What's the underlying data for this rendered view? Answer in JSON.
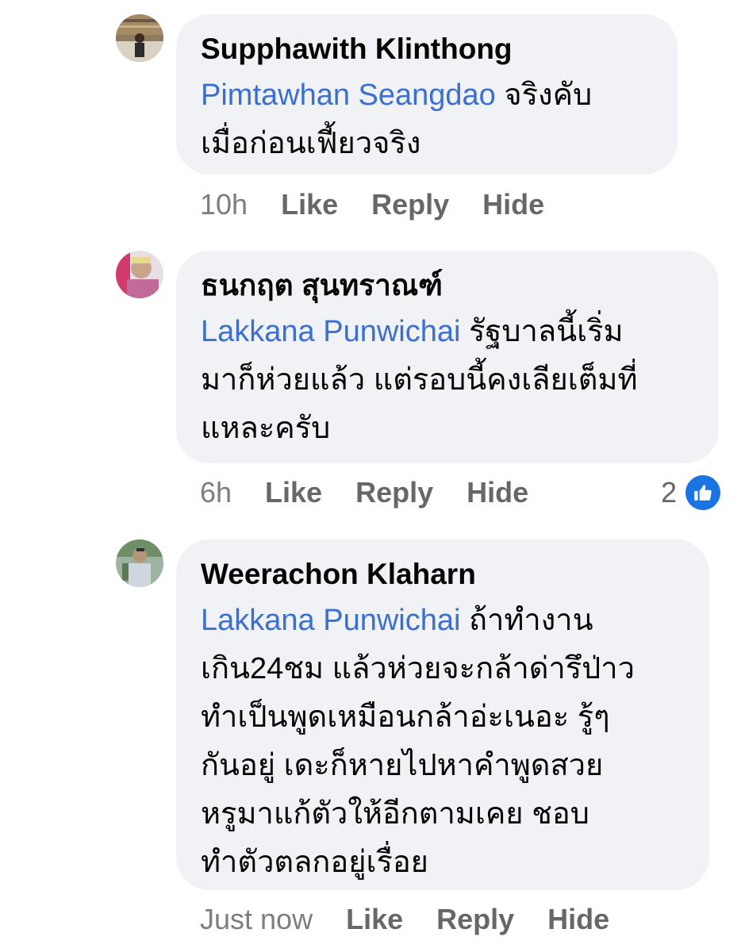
{
  "comments": [
    {
      "author": "Supphawith Klinthong",
      "mention": "Pimtawhan Seangdao",
      "text_lines": [
        " จริงคับ",
        "เมื่อก่อนเฟี้ยวจริง"
      ],
      "time": "10h",
      "like": "Like",
      "reply": "Reply",
      "hide": "Hide",
      "avatar_icon": "profile-photo-icon"
    },
    {
      "author": "ธนกฤต สุนทราณฑ์",
      "mention": "Lakkana Punwichai",
      "text_lines": [
        " รัฐบาลนี้เริ่ม",
        "มาก็ห่วยแล้ว แต่รอบนี้คงเลียเต็มที่",
        "แหละครับ"
      ],
      "time": "6h",
      "like": "Like",
      "reply": "Reply",
      "hide": "Hide",
      "reaction_count": "2",
      "reaction_icon": "thumbs-up-icon",
      "avatar_icon": "profile-photo-icon"
    },
    {
      "author": "Weerachon Klaharn",
      "mention": "Lakkana Punwichai",
      "text_lines": [
        " ถ้าทำงาน",
        "เกิน24ชม แล้วห่วยจะกล้าด่ารึป่าว",
        "ทำเป็นพูดเหมือนกล้าอ่ะเนอะ รู้ๆ",
        "กันอยู่ เดะก็หายไปหาคำพูดสวย",
        "หรูมาแก้ตัวให้อีกตามเคย ชอบ",
        "ทำตัวตลกอยู่เรื่อย"
      ],
      "time": "Just now",
      "like": "Like",
      "reply": "Reply",
      "hide": "Hide",
      "avatar_icon": "profile-photo-icon"
    }
  ],
  "colors": {
    "bubble": "#f0f2f5",
    "mention": "#3b6fd1",
    "meta": "#65676b",
    "like_badge": "#1b74e4"
  }
}
